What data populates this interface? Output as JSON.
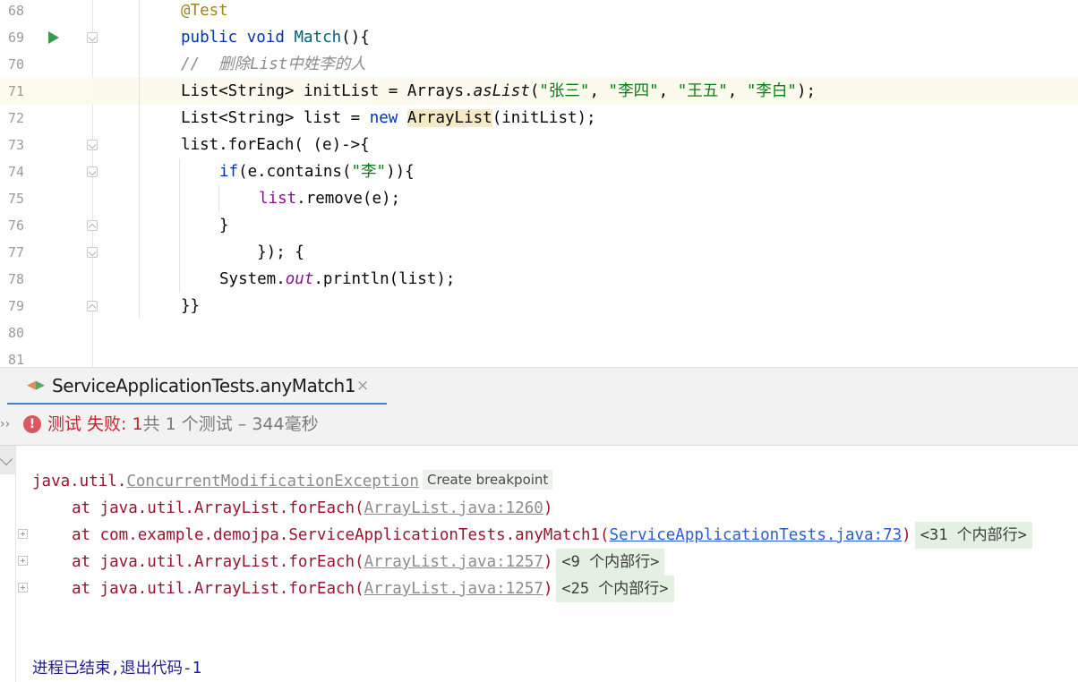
{
  "editor": {
    "lines": [
      {
        "num": "68"
      },
      {
        "num": "69"
      },
      {
        "num": "70"
      },
      {
        "num": "71"
      },
      {
        "num": "72"
      },
      {
        "num": "73"
      },
      {
        "num": "74"
      },
      {
        "num": "75"
      },
      {
        "num": "76"
      },
      {
        "num": "77"
      },
      {
        "num": "78"
      },
      {
        "num": "79"
      },
      {
        "num": "80"
      },
      {
        "num": "81"
      }
    ],
    "code": {
      "l68_annotation": "@Test",
      "l69_public": "public",
      "l69_void": "void",
      "l69_method": "Match",
      "l69_rest": "(){",
      "l70_comment": "//  删除List中姓李的人",
      "l71_a": "List<String> initList = Arrays.",
      "l71_aslist": "asList",
      "l71_open": "(",
      "l71_s1": "\"张三\"",
      "l71_s2": "\"李四\"",
      "l71_s3": "\"王五\"",
      "l71_s4": "\"李白\"",
      "l71_sep": ", ",
      "l71_close": ");",
      "l72_a": "List<String> list = ",
      "l72_new": "new",
      "l72_class": "ArrayList",
      "l72_rest": "(initList);",
      "l73": "list.forEach( (e)->{",
      "l74_if": "if",
      "l74_a": "(e.contains(",
      "l74_str": "\"李\"",
      "l74_b": ")){",
      "l75_list": "list",
      "l75_rest": ".remove(e);",
      "l76": "}",
      "l77": "    }); {",
      "l78_a": "System.",
      "l78_out": "out",
      "l78_b": ".println(list);",
      "l79": "}}"
    },
    "current_line": "71",
    "run_icon": "run-test-icon"
  },
  "tool_window": {
    "tab_label": "ServiceApplicationTests.anyMatch1",
    "tab_close": "×",
    "tab_icon": "test-diff-icon",
    "chevron": "››",
    "status": {
      "fail_icon_text": "!",
      "fail_text": "测试 失败: 1",
      "summary_text": "共 1 个测试 – 344毫秒"
    }
  },
  "console": {
    "exception_pkg": "java.util.",
    "exception_class": "ConcurrentModificationException",
    "create_breakpoint": "Create breakpoint",
    "frames": [
      {
        "prefix": "at java.util.ArrayList.forEach(",
        "link": "ArrayList.java:1260",
        "suffix": ")",
        "internal": ""
      },
      {
        "prefix": "at com.example.demojpa.ServiceApplicationTests.anyMatch1(",
        "link": "ServiceApplicationTests.java:73",
        "suffix": ")",
        "internal": "<31 个内部行>"
      },
      {
        "prefix": "at java.util.ArrayList.forEach(",
        "link": "ArrayList.java:1257",
        "suffix": ")",
        "internal": "<9 个内部行>"
      },
      {
        "prefix": "at java.util.ArrayList.forEach(",
        "link": "ArrayList.java:1257",
        "suffix": ")",
        "internal": "<25 个内部行>"
      }
    ],
    "exit_text": "进程已结束,退出代码-1"
  },
  "colors": {
    "keyword": "#0033b3",
    "annotation": "#9e880d",
    "string": "#067d17",
    "comment": "#8c8c8c",
    "error": "#98152c",
    "fail": "#c7222d",
    "link": "#2a5bd7",
    "tab_accent": "#4083c9"
  }
}
